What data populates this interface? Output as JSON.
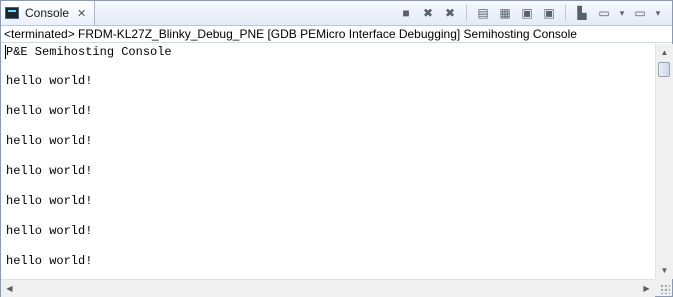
{
  "tab": {
    "icon": "console-icon",
    "label": "Console",
    "close": "✕"
  },
  "toolbar": {
    "icons": [
      {
        "name": "terminate-icon",
        "glyph": "■"
      },
      {
        "name": "remove-launch-icon",
        "glyph": "✖"
      },
      {
        "name": "remove-all-terminated-icon",
        "glyph": "✖"
      },
      {
        "name": "clear-console-icon",
        "glyph": "▤"
      },
      {
        "name": "scroll-lock-icon",
        "glyph": "▦"
      },
      {
        "name": "show-console-on-stdout-icon",
        "glyph": "▣"
      },
      {
        "name": "show-console-on-stderr-icon",
        "glyph": "▣"
      },
      {
        "name": "pin-console-icon",
        "glyph": "▙"
      },
      {
        "name": "display-selected-console-icon",
        "glyph": "▭"
      },
      {
        "name": "open-console-icon",
        "glyph": "▭"
      }
    ],
    "dropdown_glyph": "▾"
  },
  "status_line": "<terminated> FRDM-KL27Z_Blinky_Debug_PNE [GDB PEMicro Interface Debugging] Semihosting Console",
  "console_lines": [
    "P&E Semihosting Console",
    "hello world!",
    "hello world!",
    "hello world!",
    "hello world!",
    "hello world!",
    "hello world!",
    "hello world!"
  ],
  "scroll": {
    "up": "▲",
    "down": "▼",
    "left": "◀",
    "right": "▶"
  }
}
